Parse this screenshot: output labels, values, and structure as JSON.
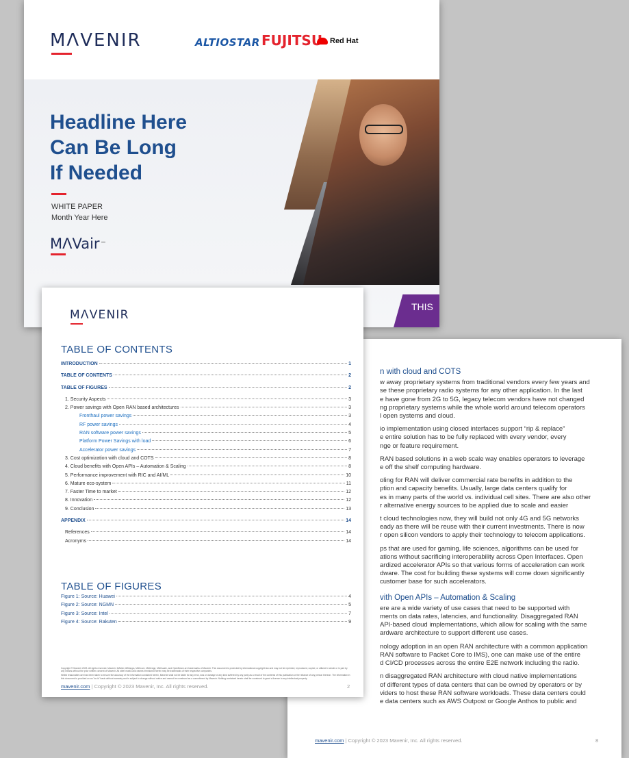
{
  "cover": {
    "mavenir_logo": "MΛVENIR",
    "partners": [
      "ALTIOSTAR",
      "FUJITSU",
      "Red Hat"
    ],
    "headline": [
      "Headline Here",
      "Can Be Long",
      "If Needed"
    ],
    "doc_type": "WHITE PAPER",
    "date": "Month Year Here",
    "product_logo": "MΛVair",
    "purple_tab_text": "THIS",
    "colors": {
      "brand_navy": "#1f2d5a",
      "headline_blue": "#1f4f8e",
      "accent_red": "#e4232d",
      "purple": "#6b2d8f"
    }
  },
  "toc_page": {
    "logo": "MΛVENIR",
    "title": "TABLE OF CONTENTS",
    "entries": [
      {
        "label": "INTRODUCTION",
        "page": "1",
        "level": "top"
      },
      {
        "label": "TABLE OF CONTENTS",
        "page": "2",
        "level": "top"
      },
      {
        "label": "TABLE OF FIGURES",
        "page": "2",
        "level": "top"
      },
      {
        "label": "1. Security Aspects",
        "page": "3",
        "level": "lvl1"
      },
      {
        "label": "2. Power savings with Open RAN based architectures",
        "page": "3",
        "level": "lvl1"
      },
      {
        "label": "Fronthaul power savings",
        "page": "3",
        "level": "lvl2"
      },
      {
        "label": "RF power savings",
        "page": "4",
        "level": "lvl2"
      },
      {
        "label": "RAN software power savings",
        "page": "5",
        "level": "lvl2"
      },
      {
        "label": "Platform Power Savings with load",
        "page": "6",
        "level": "lvl2"
      },
      {
        "label": "Accelerator power savings",
        "page": "7",
        "level": "lvl2"
      },
      {
        "label": "3. Cost optimization with cloud and COTS",
        "page": "8",
        "level": "lvl1"
      },
      {
        "label": "4. Cloud benefits with Open APIs – Automation & Scaling",
        "page": "8",
        "level": "lvl1"
      },
      {
        "label": "5. Performance improvement with RIC and AI/ML",
        "page": "10",
        "level": "lvl1"
      },
      {
        "label": "6. Mature eco-system",
        "page": "11",
        "level": "lvl1"
      },
      {
        "label": "7. Faster Time to market",
        "page": "12",
        "level": "lvl1"
      },
      {
        "label": "8. Innovation",
        "page": "12",
        "level": "lvl1"
      },
      {
        "label": "9. Conclusion",
        "page": "13",
        "level": "lvl1"
      }
    ],
    "appendix": {
      "label": "APPENDIX",
      "page": "14"
    },
    "appendix_entries": [
      {
        "label": "References",
        "page": "14"
      },
      {
        "label": "Acronyms",
        "page": "14"
      }
    ],
    "figures_title": "TABLE OF FIGURES",
    "figures": [
      {
        "label": "Figure 1: Source: Huawei",
        "page": "4"
      },
      {
        "label": "Figure 2: Source: NGMN",
        "page": "5"
      },
      {
        "label": "Figure 3: Source: Intel",
        "page": "7"
      },
      {
        "label": "Figure 4: Source: Rakuten",
        "page": "9"
      }
    ],
    "copyright_1": "Copyright © Mavenir 2023. All rights reserved. Mavenir, MAVair, MAVapps, MAVcore, MAVedge, MAVscale, and OpenBeam are trademarks of Mavenir. This document is protected by international copyright law and may not be reprinted, reproduced, copied, or utilized in whole or in part by any means without the prior written consent of Mavenir. All other marks and names mentioned herein may be trademarks of their respective companies.",
    "copyright_2": "Whilst reasonable care has been taken to ensure the accuracy of the information contained herein, Mavenir shall not be liable for any error, loss or damage of any kind suffered by any party as a result of the contents of this publication or the reliance of any person thereon. The information in this document is provided on an \"as is\" basis without warranty and is subject to change without notice and cannot be construed as a commitment by Mavenir. Nothing contained herein shall be construed to grant a license to any intellectual property.",
    "footer_link": "mavenir.com",
    "footer_text": " | Copyright © 2023 Mavenir, Inc. All rights reserved.",
    "page_number": "2"
  },
  "page8": {
    "heading1": "n with cloud and COTS",
    "paragraphs1": [
      [
        "w away proprietary systems from traditional vendors every few years and",
        "se these proprietary radio systems for any other application. In the last",
        "e have gone from 2G to 5G, legacy telecom vendors have not changed",
        "ng proprietary systems while the whole world around telecom operators",
        "l open systems and cloud."
      ],
      [
        "io implementation using closed interfaces support “rip & replace”",
        "e entire solution has to be fully replaced with every vendor, every",
        "nge or feature requirement."
      ],
      [
        "RAN based solutions in a web scale way enables operators to leverage",
        "e off the shelf computing hardware."
      ],
      [
        "oling for RAN will deliver commercial rate benefits in addition to the",
        "ption and capacity benefits. Usually, large data centers qualify for",
        "es in many parts of the world vs. individual cell sites. There are also other",
        "r alternative energy sources to be applied due to scale and easier"
      ],
      [
        "t cloud technologies now, they will build not only 4G and 5G networks",
        "eady as there will be reuse with their current investments. There is now",
        "r open silicon vendors to apply their technology to telecom applications."
      ],
      [
        "ps that are used for gaming, life sciences, algorithms can be used for",
        "ations without sacrificing interoperability across Open Interfaces. Open",
        "ardized accelerator APIs so that various forms of acceleration can work",
        "dware. The cost for building these systems will come down significantly",
        "customer base for such accelerators."
      ]
    ],
    "heading2": "vith Open APIs – Automation & Scaling",
    "paragraphs2": [
      [
        "ere are a wide variety of use cases that need to be supported with",
        "ments on data rates, latencies, and functionality. Disaggregated RAN",
        "API-based cloud implementations, which allow for scaling with the same",
        "ardware architecture to support different use cases."
      ],
      [
        "nology adoption in an open RAN architecture with a common application",
        "RAN software to Packet Core to IMS), one can make use of the entire",
        "d CI/CD processes across the entire E2E network including the radio."
      ],
      [
        "n disaggregated RAN architecture with cloud native implementations",
        "of different types of data centers that can be owned by operators or by",
        "viders to host these RAN software workloads. These data centers could",
        "e data centers such as AWS Outpost or Google Anthos to public and"
      ]
    ],
    "footer_link": "mavenir.com",
    "footer_text": " | Copyright © 2023 Mavenir, Inc. All rights reserved.",
    "page_number": "8"
  }
}
